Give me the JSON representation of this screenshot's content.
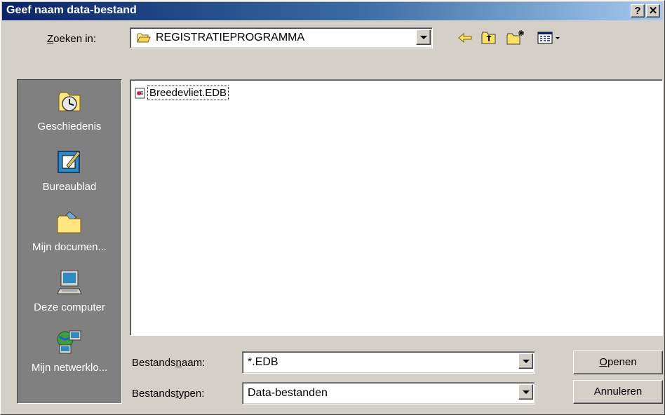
{
  "window": {
    "title": "Geef naam data-bestand",
    "help_glyph": "?",
    "close_glyph": "✕"
  },
  "lookin": {
    "label_pre": "",
    "label_accel": "Z",
    "label_post": "oeken in:",
    "value": "REGISTRATIEPROGRAMMA"
  },
  "toolbar": {
    "icons": [
      "back-icon",
      "up-folder-icon",
      "new-folder-icon",
      "view-menu-icon"
    ]
  },
  "places": [
    {
      "label": "Geschiedenis",
      "icon": "history-icon"
    },
    {
      "label": "Bureaublad",
      "icon": "desktop-icon"
    },
    {
      "label": "Mijn documen...",
      "icon": "my-documents-icon"
    },
    {
      "label": "Deze computer",
      "icon": "my-computer-icon"
    },
    {
      "label": "Mijn netwerklo...",
      "icon": "network-places-icon"
    }
  ],
  "files": [
    {
      "name": "Breedevliet.EDB",
      "icon": "edb-file-icon"
    }
  ],
  "filename": {
    "label_pre": "Bestands",
    "label_accel": "n",
    "label_post": "aam:",
    "value": "*.EDB"
  },
  "filetype": {
    "label_pre": "Bestands",
    "label_accel": "t",
    "label_post": "ypen:",
    "value": "Data-bestanden"
  },
  "buttons": {
    "open_accel": "O",
    "open_rest": "penen",
    "cancel": "Annuleren"
  },
  "colors": {
    "titlebar_start": "#0a246a",
    "titlebar_end": "#a6caf0",
    "face": "#d4d0c8",
    "places_bg": "#808080"
  }
}
